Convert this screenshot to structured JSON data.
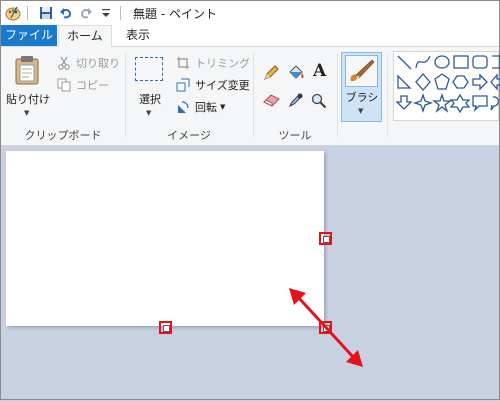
{
  "window": {
    "title": "無題 - ペイント"
  },
  "tabs": {
    "file": "ファイル",
    "home": "ホーム",
    "view": "表示"
  },
  "ribbon": {
    "clipboard": {
      "paste": "貼り付け",
      "cut": "切り取り",
      "copy": "コピー",
      "label": "クリップボード"
    },
    "image": {
      "select": "選択",
      "crop": "トリミング",
      "resize": "サイズ変更",
      "rotate": "回転",
      "label": "イメージ"
    },
    "tools": {
      "text_glyph": "A",
      "label": "ツール"
    },
    "brushes": {
      "label": "ブラシ"
    }
  },
  "colors": {
    "accent": "#1979ca",
    "highlight": "#e8111a",
    "canvas_bg": "#c8d1e2"
  }
}
